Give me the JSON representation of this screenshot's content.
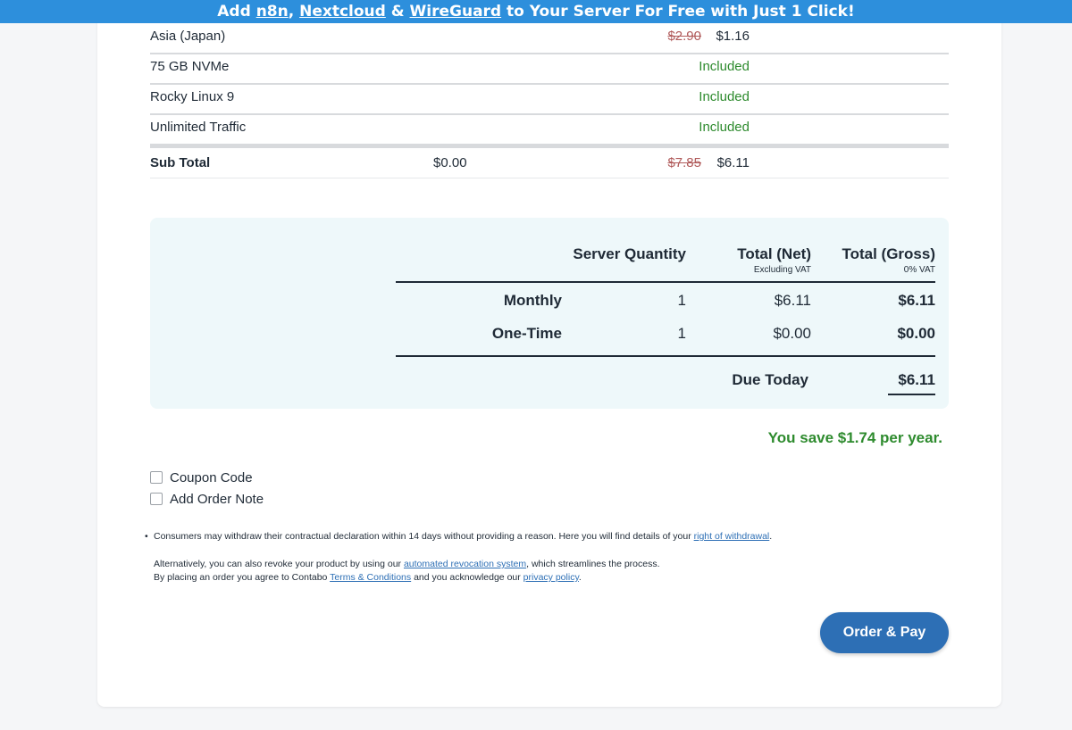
{
  "banner": {
    "prefix": "Add ",
    "link1": "n8n",
    "sep1": ", ",
    "link2": "Nextcloud",
    "sep2": " & ",
    "link3": "WireGuard",
    "suffix": " to Your Server For Free with Just 1 Click!"
  },
  "items": [
    {
      "name": "Asia (Japan)",
      "old_price": "$2.90",
      "price": "$1.16"
    },
    {
      "name": "75 GB NVMe",
      "status": "Included"
    },
    {
      "name": "Rocky Linux 9",
      "status": "Included"
    },
    {
      "name": "Unlimited Traffic",
      "status": "Included"
    }
  ],
  "subtotal": {
    "label": "Sub Total",
    "onetime": "$0.00",
    "old_price": "$7.85",
    "price": "$6.11"
  },
  "summary": {
    "col_quantity": "Server Quantity",
    "col_net": "Total (Net)",
    "col_net_sub": "Excluding VAT",
    "col_gross": "Total (Gross)",
    "col_gross_sub": "0% VAT",
    "rows": [
      {
        "label": "Monthly",
        "qty": "1",
        "net": "$6.11",
        "gross": "$6.11"
      },
      {
        "label": "One-Time",
        "qty": "1",
        "net": "$0.00",
        "gross": "$0.00"
      }
    ],
    "due_label": "Due Today",
    "due_value": "$6.11"
  },
  "savings": "You save $1.74 per year.",
  "options": {
    "coupon": "Coupon Code",
    "note": "Add Order Note"
  },
  "legal": {
    "line1_a": "Consumers may withdraw their contractual declaration within 14 days without providing a reason. Here you will find details of your ",
    "line1_link": "right of withdrawal",
    "line1_b": ".",
    "line2_a": "Alternatively, you can also revoke your product by using our ",
    "line2_link": "automated revocation system",
    "line2_b": ", which streamlines the process.",
    "line3_a": "By placing an order you agree to Contabo ",
    "line3_link1": "Terms & Conditions",
    "line3_b": " and you acknowledge our ",
    "line3_link2": "privacy policy",
    "line3_c": "."
  },
  "order_button": "Order & Pay",
  "colors": {
    "accent": "#2d6fb5",
    "banner": "#2d8fdc",
    "green": "#2e8b2e",
    "summary_bg": "#eef8fa"
  }
}
